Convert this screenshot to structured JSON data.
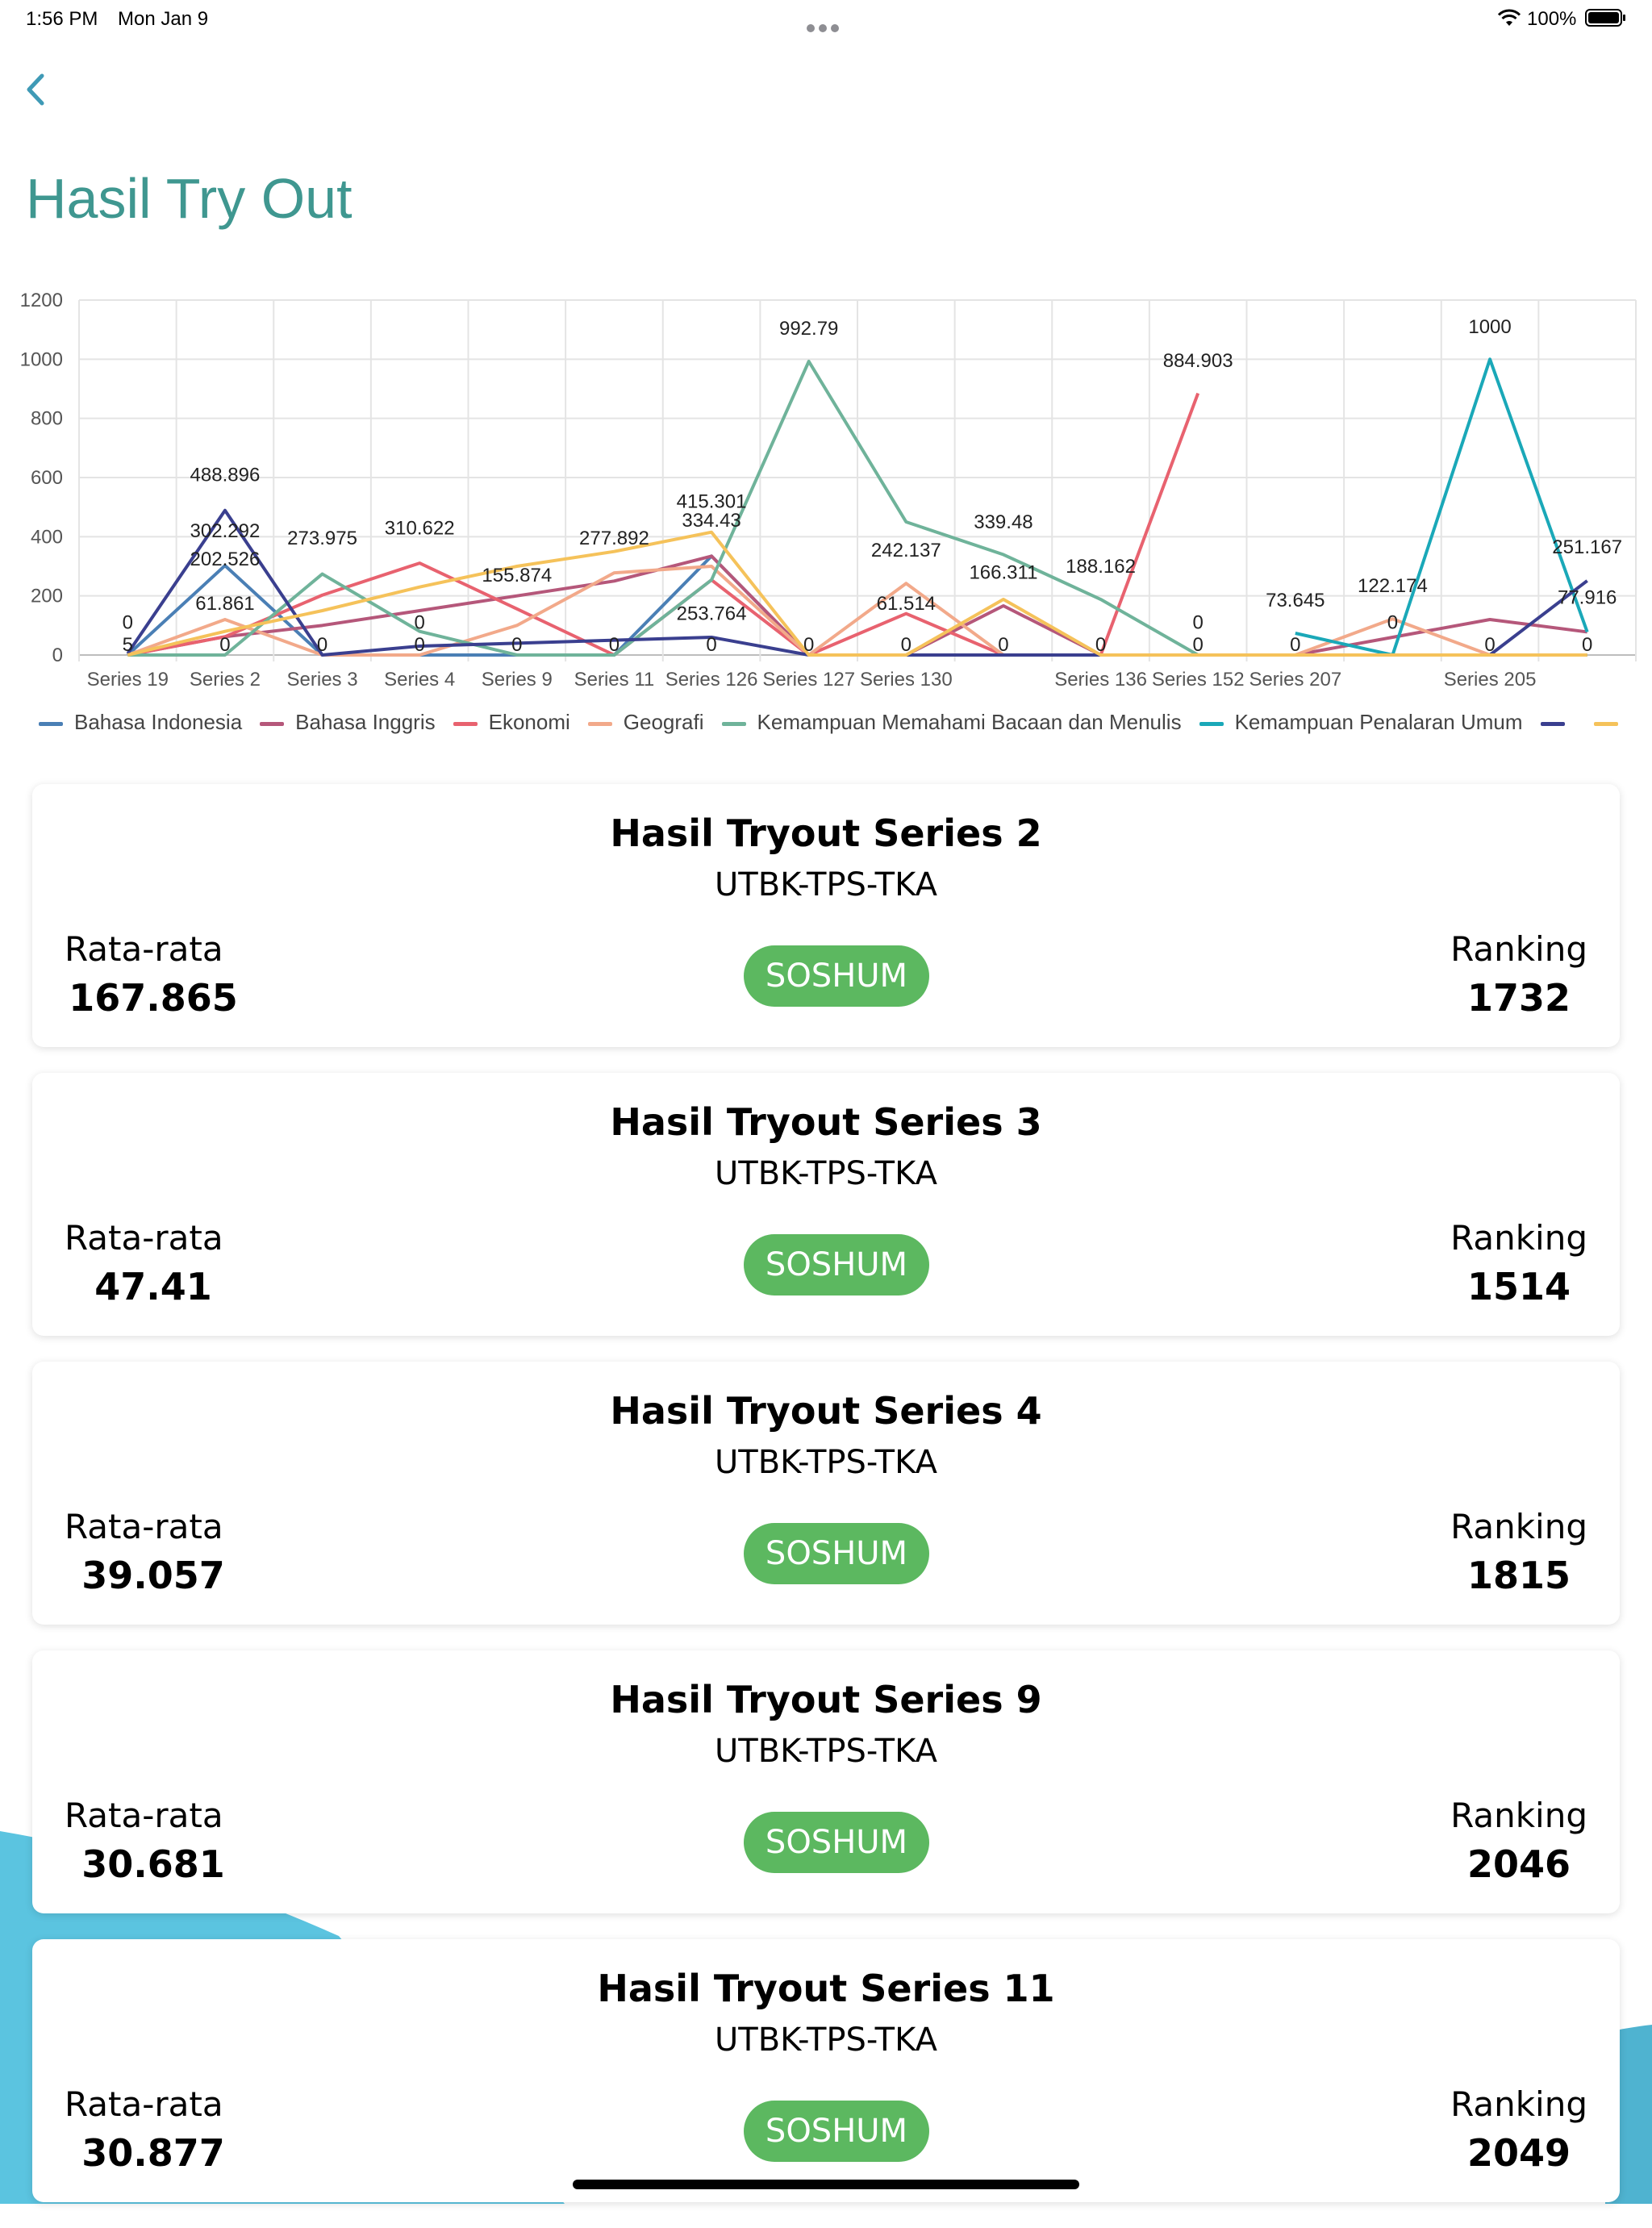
{
  "status_bar": {
    "time": "1:56 PM",
    "date": "Mon Jan 9",
    "battery": "100%"
  },
  "header": {
    "back_icon": "chevron-left-icon",
    "title": "Hasil Try Out"
  },
  "colors": {
    "title": "#3f9790",
    "badge": "#5cb860",
    "background_wave": "#5bc4e0"
  },
  "chart_data": {
    "type": "line",
    "categories": [
      "Series 19",
      "Series 2",
      "Series 3",
      "Series 4",
      "Series 9",
      "Series 11",
      "Series 126",
      "Series 127",
      "Series 130",
      "",
      "Series 136",
      "Series 152",
      "Series 207",
      "",
      "Series 205",
      ""
    ],
    "ylim": [
      0,
      1200
    ],
    "yticks": [
      0,
      200,
      400,
      600,
      800,
      1000,
      1200
    ],
    "grid": true,
    "legend_position": "bottom",
    "series": [
      {
        "name": "Bahasa Indonesia",
        "color": "#4a7fb5",
        "values": [
          0,
          302.292,
          0,
          0,
          0,
          0,
          334.43,
          0,
          0,
          0,
          0,
          0,
          0,
          0,
          0,
          0
        ]
      },
      {
        "name": "Bahasa Inggris",
        "color": "#b5577a",
        "values": [
          0,
          61.861,
          100,
          150,
          200,
          250,
          334.43,
          0,
          0,
          166.311,
          0,
          0,
          0,
          60,
          120,
          77.916
        ]
      },
      {
        "name": "Ekonomi",
        "color": "#e8626f",
        "values": [
          0,
          61.861,
          202.526,
          310.622,
          155.874,
          0,
          253.764,
          0,
          140,
          0,
          0,
          884.903,
          null,
          null,
          null,
          null
        ]
      },
      {
        "name": "Geografi",
        "color": "#f2a98a",
        "values": [
          0,
          120,
          0,
          0,
          100,
          277.892,
          300,
          0,
          242.137,
          0,
          0,
          0,
          0,
          122.174,
          0,
          0
        ]
      },
      {
        "name": "Kemampuan Memahami Bacaan dan Menulis",
        "color": "#6fb39a",
        "values": [
          0,
          0,
          273.975,
          80,
          0,
          0,
          253.764,
          992.79,
          450,
          339.48,
          188.162,
          0,
          0,
          0,
          0,
          0
        ]
      },
      {
        "name": "Kemampuan Penalaran Umum",
        "color": "#1aa8b8",
        "values": [
          null,
          null,
          null,
          null,
          null,
          null,
          null,
          null,
          null,
          null,
          null,
          null,
          73.645,
          0,
          1000,
          77.916
        ]
      },
      {
        "name": "",
        "color": "#3a3f8f",
        "values": [
          5,
          488.896,
          0,
          30,
          40,
          50,
          60,
          0,
          0,
          0,
          0,
          0,
          null,
          null,
          0,
          251.167
        ]
      },
      {
        "name": "",
        "color": "#f5c25a",
        "values": [
          0,
          80,
          150,
          230,
          300,
          350,
          415.301,
          0,
          0,
          188.162,
          0,
          0,
          0,
          0,
          0,
          0
        ]
      }
    ],
    "data_labels": [
      {
        "text": "0",
        "col": 0,
        "value": 110
      },
      {
        "text": "5",
        "col": 0,
        "value": 35
      },
      {
        "text": "488.896",
        "col": 1,
        "value": 610
      },
      {
        "text": "302.292",
        "col": 1,
        "value": 420
      },
      {
        "text": "202.526",
        "col": 1,
        "value": 325
      },
      {
        "text": "61.861",
        "col": 1,
        "value": 175
      },
      {
        "text": "0",
        "col": 1,
        "value": 35
      },
      {
        "text": "273.975",
        "col": 2,
        "value": 395
      },
      {
        "text": "0",
        "col": 2,
        "value": 35
      },
      {
        "text": "310.622",
        "col": 3,
        "value": 430
      },
      {
        "text": "0",
        "col": 3,
        "value": 110
      },
      {
        "text": "0",
        "col": 3,
        "value": 35
      },
      {
        "text": "155.874",
        "col": 4,
        "value": 270
      },
      {
        "text": "0",
        "col": 4,
        "value": 35
      },
      {
        "text": "277.892",
        "col": 5,
        "value": 395
      },
      {
        "text": "0",
        "col": 5,
        "value": 35
      },
      {
        "text": "415.301",
        "col": 6,
        "value": 520
      },
      {
        "text": "334.43",
        "col": 6,
        "value": 455
      },
      {
        "text": "253.764",
        "col": 6,
        "value": 140
      },
      {
        "text": "0",
        "col": 6,
        "value": 35
      },
      {
        "text": "992.79",
        "col": 7,
        "value": 1105
      },
      {
        "text": "0",
        "col": 7,
        "value": 35
      },
      {
        "text": "242.137",
        "col": 8,
        "value": 355
      },
      {
        "text": "61.514",
        "col": 8,
        "value": 175
      },
      {
        "text": "0",
        "col": 8,
        "value": 35
      },
      {
        "text": "339.48",
        "col": 9,
        "value": 450
      },
      {
        "text": "166.311",
        "col": 9,
        "value": 280
      },
      {
        "text": "0",
        "col": 9,
        "value": 35
      },
      {
        "text": "188.162",
        "col": 10,
        "value": 300
      },
      {
        "text": "0",
        "col": 10,
        "value": 35
      },
      {
        "text": "884.903",
        "col": 11,
        "value": 995
      },
      {
        "text": "0",
        "col": 11,
        "value": 110
      },
      {
        "text": "0",
        "col": 11,
        "value": 35
      },
      {
        "text": "73.645",
        "col": 12,
        "value": 185
      },
      {
        "text": "0",
        "col": 12,
        "value": 35
      },
      {
        "text": "122.174",
        "col": 13,
        "value": 235
      },
      {
        "text": "0",
        "col": 13,
        "value": 110
      },
      {
        "text": "1000",
        "col": 14,
        "value": 1110
      },
      {
        "text": "0",
        "col": 14,
        "value": 35
      },
      {
        "text": "251.167",
        "col": 15,
        "value": 365
      },
      {
        "text": "77.916",
        "col": 15,
        "value": 195
      },
      {
        "text": "0",
        "col": 15,
        "value": 35
      }
    ]
  },
  "cards": [
    {
      "title": "Hasil Tryout Series 2",
      "subtitle": "UTBK-TPS-TKA",
      "avg_label": "Rata-rata",
      "avg_value": "167.865",
      "badge": "SOSHUM",
      "rank_label": "Ranking",
      "rank_value": "1732"
    },
    {
      "title": "Hasil Tryout Series 3",
      "subtitle": "UTBK-TPS-TKA",
      "avg_label": "Rata-rata",
      "avg_value": "47.41",
      "badge": "SOSHUM",
      "rank_label": "Ranking",
      "rank_value": "1514"
    },
    {
      "title": "Hasil Tryout Series 4",
      "subtitle": "UTBK-TPS-TKA",
      "avg_label": "Rata-rata",
      "avg_value": "39.057",
      "badge": "SOSHUM",
      "rank_label": "Ranking",
      "rank_value": "1815"
    },
    {
      "title": "Hasil Tryout Series 9",
      "subtitle": "UTBK-TPS-TKA",
      "avg_label": "Rata-rata",
      "avg_value": "30.681",
      "badge": "SOSHUM",
      "rank_label": "Ranking",
      "rank_value": "2046"
    },
    {
      "title": "Hasil Tryout Series 11",
      "subtitle": "UTBK-TPS-TKA",
      "avg_label": "Rata-rata",
      "avg_value": "30.877",
      "badge": "SOSHUM",
      "rank_label": "Ranking",
      "rank_value": "2049"
    }
  ]
}
